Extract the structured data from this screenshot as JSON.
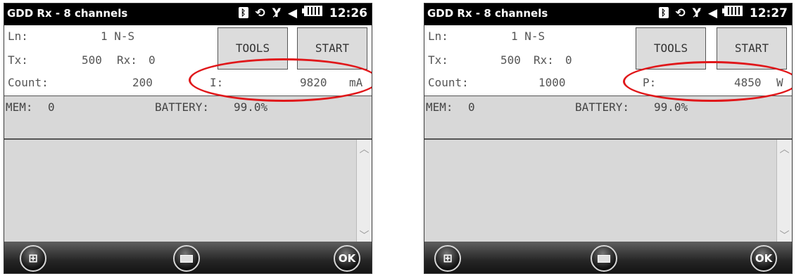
{
  "screens": [
    {
      "title": "GDD Rx - 8 channels",
      "clock": "12:26",
      "line_label": "Ln:",
      "line_value": "1 N-S",
      "tx_label": "Tx:",
      "tx_value": "500",
      "rx_label": "Rx:",
      "rx_value": "0",
      "count_label": "Count:",
      "count_value": "200",
      "reading_label": "I:",
      "reading_value": "9820",
      "reading_unit": "mA",
      "tools_button": "TOOLS",
      "start_button": "START",
      "mem_label": "MEM:",
      "mem_value": "0",
      "battery_label": "BATTERY:",
      "battery_value": "99.0%",
      "ok_button": "OK"
    },
    {
      "title": "GDD Rx - 8 channels",
      "clock": "12:27",
      "line_label": "Ln:",
      "line_value": "1 N-S",
      "tx_label": "Tx:",
      "tx_value": "500",
      "rx_label": "Rx:",
      "rx_value": "0",
      "count_label": "Count:",
      "count_value": "1000",
      "reading_label": "P:",
      "reading_value": "4850",
      "reading_unit": "W",
      "tools_button": "TOOLS",
      "start_button": "START",
      "mem_label": "MEM:",
      "mem_value": "0",
      "battery_label": "BATTERY:",
      "battery_value": "99.0%",
      "ok_button": "OK"
    }
  ],
  "icons": {
    "bluetooth": "bluetooth-icon",
    "sync": "sync-icon",
    "signal": "no-signal-icon",
    "volume": "volume-icon",
    "battery": "battery-icon",
    "windows": "windows-start-icon",
    "keyboard": "keyboard-icon"
  },
  "colors": {
    "highlight_circle": "#e0171a",
    "title_bar": "#000000",
    "panel": "#d8d8d8"
  }
}
